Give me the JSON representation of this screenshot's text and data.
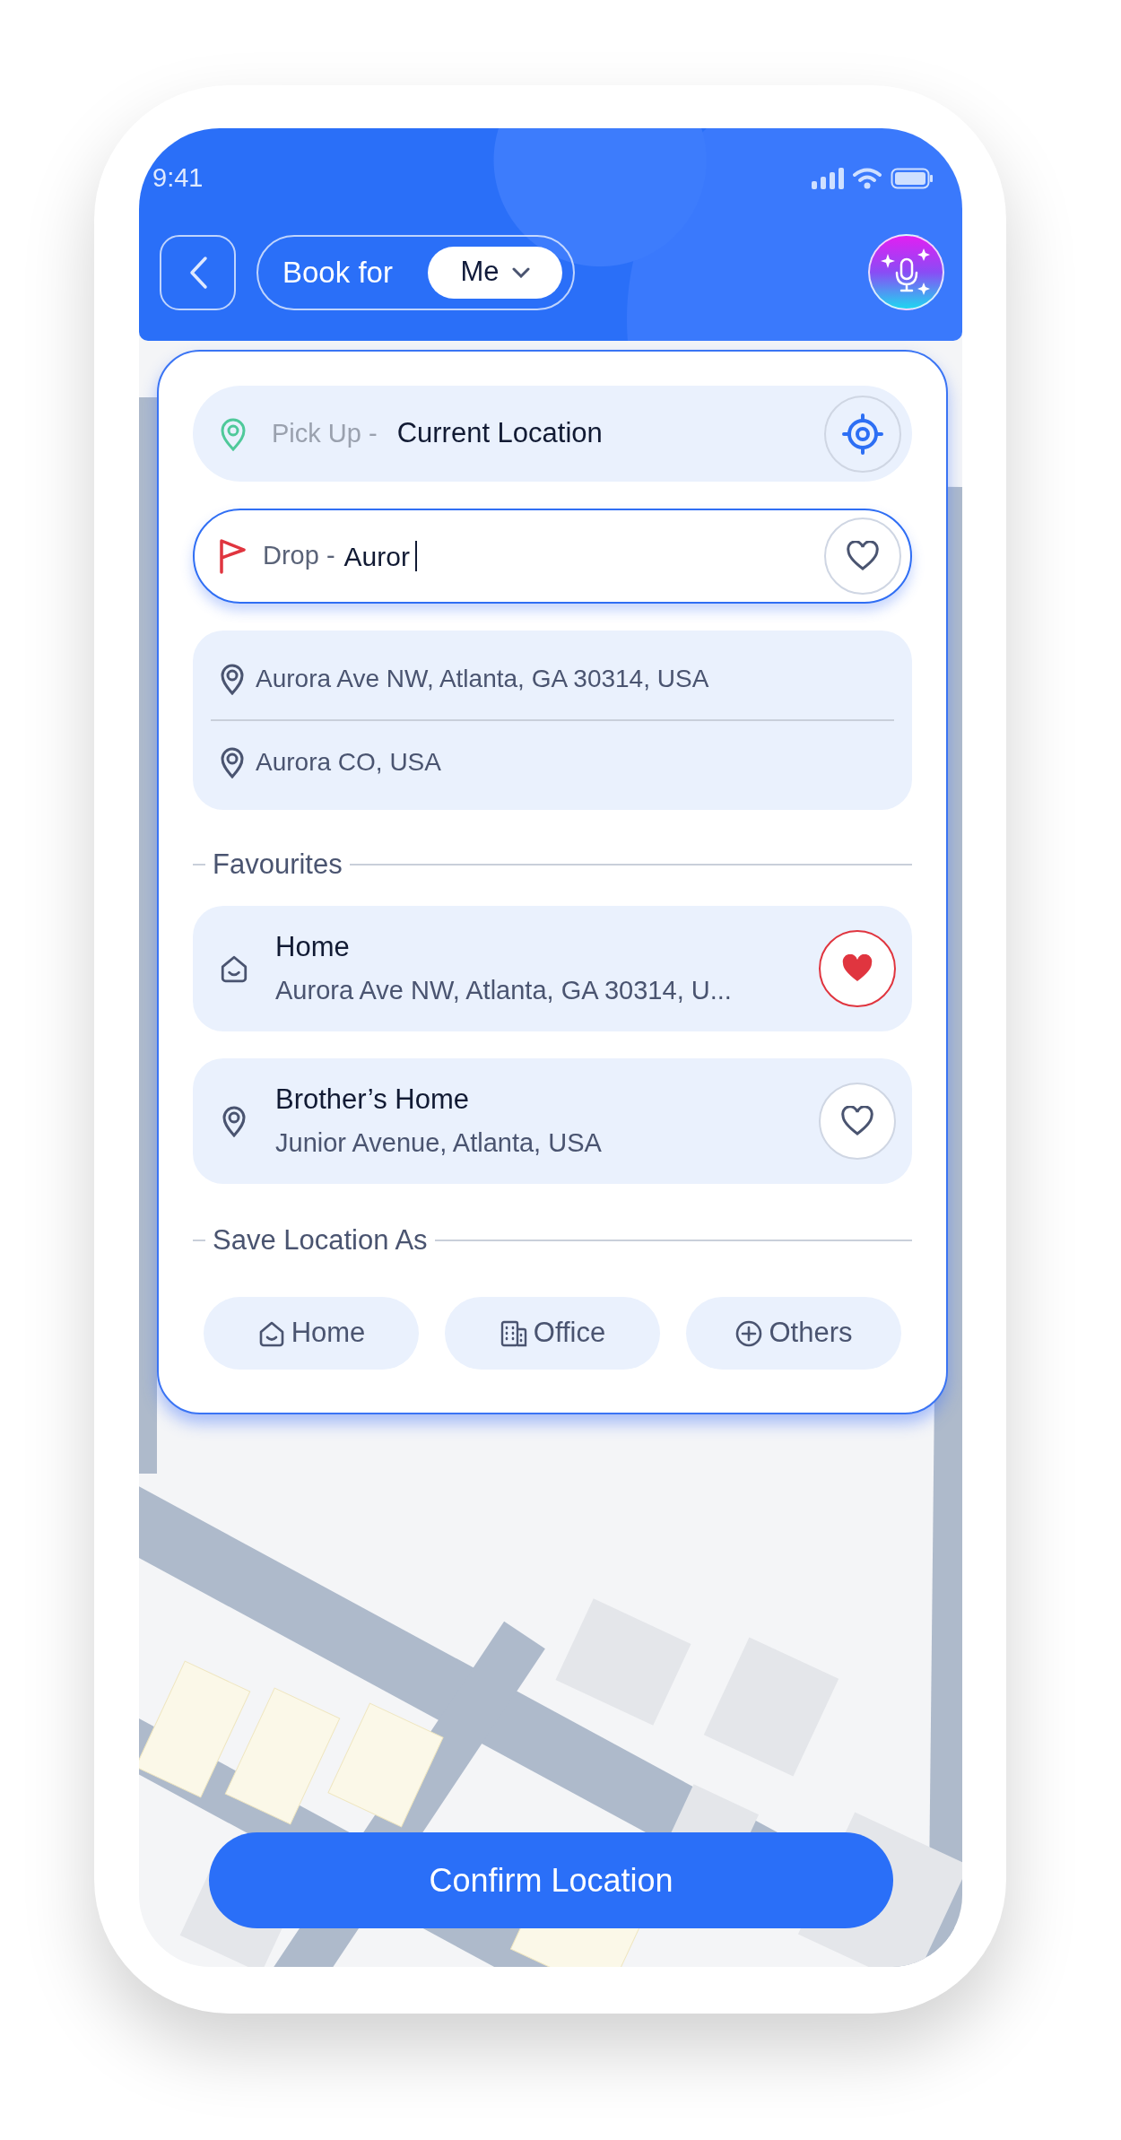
{
  "status_bar": {
    "time": "9:41"
  },
  "header": {
    "book_for_label": "Book for",
    "book_for_value": "Me"
  },
  "pickup": {
    "label": "Pick Up -",
    "value": "Current Location"
  },
  "drop": {
    "label": "Drop -",
    "value": "Auror",
    "favourite": false
  },
  "suggestions": [
    {
      "text": "Aurora Ave NW, Atlanta, GA 30314, USA"
    },
    {
      "text": "Aurora CO, USA"
    }
  ],
  "favourites": {
    "title": "Favourites",
    "items": [
      {
        "kind": "home",
        "name": "Home",
        "address": "Aurora Ave NW, Atlanta, GA 30314, U...",
        "favourite": true
      },
      {
        "kind": "pin",
        "name": "Brother’s Home",
        "address": "Junior Avenue, Atlanta, USA",
        "favourite": false
      }
    ]
  },
  "save_as": {
    "title": "Save Location As",
    "options": [
      {
        "kind": "home",
        "label": "Home"
      },
      {
        "kind": "office",
        "label": "Office"
      },
      {
        "kind": "other",
        "label": "Others"
      }
    ]
  },
  "confirm_button": "Confirm Location"
}
